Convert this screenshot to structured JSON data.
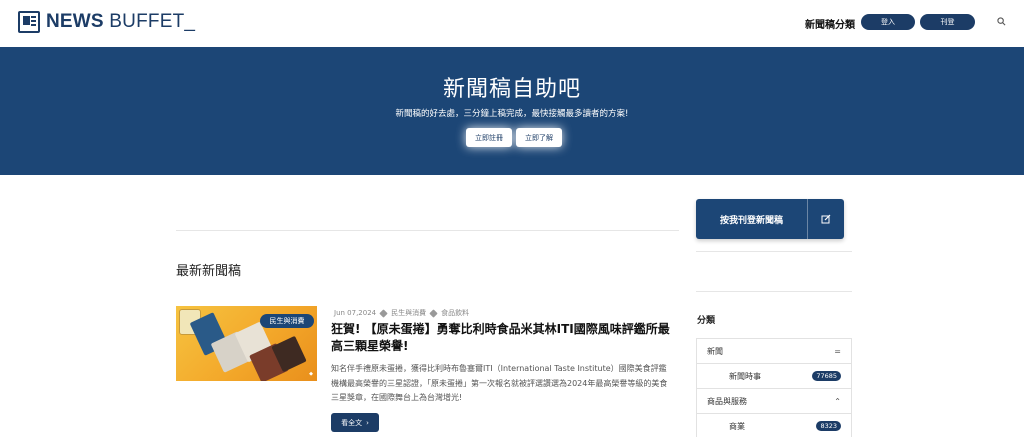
{
  "header": {
    "logo_main": "NEWS",
    "logo_sub": "BUFFET",
    "logo_tail": "_",
    "nav_category": "新聞稿分類",
    "login_label": "登入",
    "signup_label": "刊登"
  },
  "hero": {
    "title": "新聞稿自助吧",
    "subtitle": "新聞稿的好去處，三分鐘上稿完成，最快接觸最多讀者的方案!",
    "register_label": "立即註冊",
    "learn_label": "立即了解"
  },
  "main": {
    "section_title": "最新新聞稿",
    "article": {
      "date": "Jun 07,2024",
      "category": "民生與消費",
      "tag": "食品飲料",
      "thumb_tag": "民生與消費",
      "title": "狂賀! 【原未蛋捲】勇奪比利時食品米其林ITI國際風味評鑑所最高三顆星榮譽!",
      "excerpt": "知名伴手禮原未蛋捲，獲得比利時布魯塞爾ITI（International Taste Institute）國際美食評鑑機構最高榮譽的三星認證，「原未蛋捲」第一次報名就被評選讚選為2024年最高榮譽等級的美食三星獎章，在國際舞台上為台灣增光!",
      "read_more_label": "看全文"
    }
  },
  "sidebar": {
    "cta_label": "按我刊登新聞稿",
    "categories_title": "分類",
    "categories": [
      {
        "label": "新聞",
        "toggle": "="
      },
      {
        "label": "新聞時事",
        "count": "77685"
      },
      {
        "label": "商品與服務",
        "toggle": "⌃"
      },
      {
        "label": "商業",
        "count": "8323"
      }
    ]
  },
  "colors": {
    "brand": "#1c3c66",
    "hero_bg": "#1c4676"
  }
}
